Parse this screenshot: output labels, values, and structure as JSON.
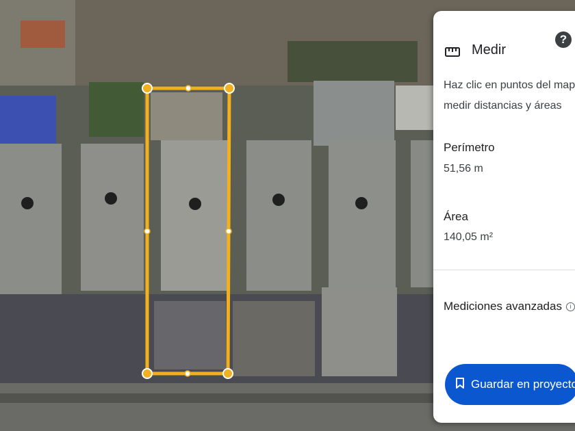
{
  "panel": {
    "title": "Medir",
    "title_icon": "ruler-icon",
    "help_icon": "help-icon",
    "help_glyph": "?",
    "instructions": "Haz clic en puntos del mapa para medir distancias y áreas",
    "perimeter_label": "Perímetro",
    "perimeter_value": "51,56 m",
    "area_label": "Área",
    "area_value": "140,05 m²",
    "advanced_label": "Mediciones avanzadas",
    "advanced_icon": "info-icon",
    "save_label": "Guardar en proyecto",
    "save_icon": "bookmark-icon"
  },
  "colors": {
    "outline": "#f2b01e",
    "accent": "#0b57d0"
  }
}
